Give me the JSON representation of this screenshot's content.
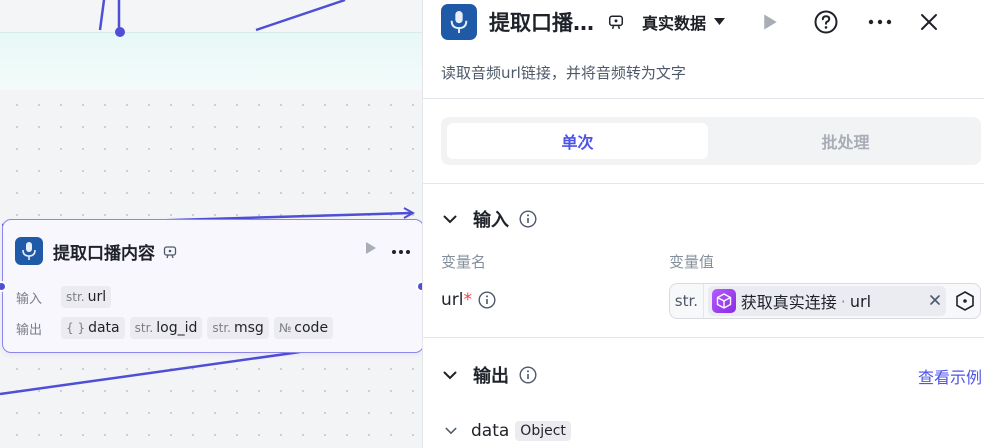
{
  "canvas": {
    "node": {
      "title": "提取口播内容",
      "input_label": "输入",
      "output_label": "输出",
      "inputs": [
        {
          "type": "str.",
          "name": "url"
        }
      ],
      "outputs": [
        {
          "type": "{ }",
          "name": "data"
        },
        {
          "type": "str.",
          "name": "log_id"
        },
        {
          "type": "str.",
          "name": "msg"
        },
        {
          "type": "№",
          "name": "code"
        }
      ]
    }
  },
  "panel": {
    "title": "提取口播…",
    "data_mode": "真实数据",
    "description": "读取音频url链接，并将音频转为文字",
    "tabs": [
      {
        "label": "单次",
        "active": true
      },
      {
        "label": "批处理",
        "active": false
      }
    ],
    "inputs_section": {
      "title": "输入",
      "col_name": "变量名",
      "col_value": "变量值",
      "var_name": "url",
      "required_mark": "*",
      "value_type": "str.",
      "ref_source": "获取真实连接",
      "ref_sep": "·",
      "ref_field": "url"
    },
    "outputs_section": {
      "title": "输出",
      "example_link": "查看示例",
      "first_output": {
        "name": "data",
        "type": "Object"
      }
    }
  },
  "colors": {
    "accent": "#4d53e8",
    "edge": "#4e4fd6",
    "node_border": "#8d85e8",
    "required": "#f53f3f"
  }
}
